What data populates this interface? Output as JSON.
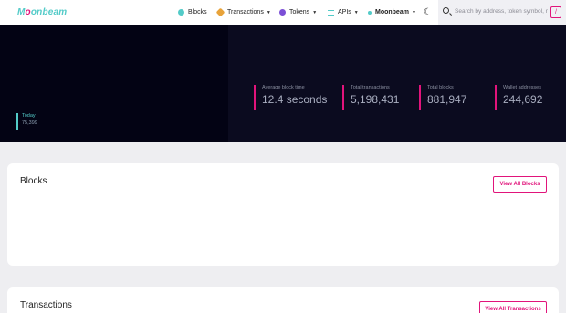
{
  "brand": {
    "logo_pre": "M",
    "logo_o": "o",
    "logo_post": "onbeam"
  },
  "nav": {
    "blocks": "Blocks",
    "transactions": "Transactions",
    "tokens": "Tokens",
    "apis": "APIs",
    "network": "Moonbeam"
  },
  "search": {
    "placeholder": "Search by address, token symbol, n",
    "shortcut": "/"
  },
  "hero": {
    "today_label": "Today",
    "today_value": "75,399",
    "stats": [
      {
        "label": "Average block time",
        "value": "12.4 seconds"
      },
      {
        "label": "Total transactions",
        "value": "5,198,431"
      },
      {
        "label": "Total blocks",
        "value": "881,947"
      },
      {
        "label": "Wallet addresses",
        "value": "244,692"
      }
    ]
  },
  "blocks_card": {
    "title": "Blocks",
    "button": "View All Blocks"
  },
  "transactions_card": {
    "title": "Transactions",
    "button": "View All Transactions"
  },
  "colors": {
    "accent": "#e1147b",
    "teal": "#53cbc8",
    "hero_bg": "#030314"
  }
}
